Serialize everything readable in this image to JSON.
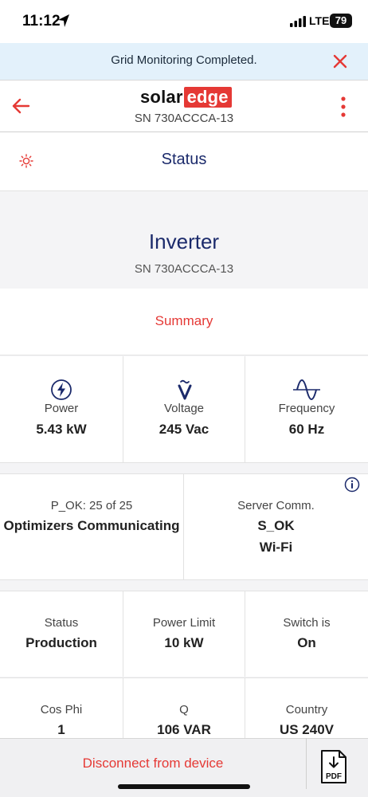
{
  "status_bar": {
    "time": "11:12",
    "network": "LTE",
    "battery": "79"
  },
  "banner": {
    "message": "Grid Monitoring Completed."
  },
  "app_bar": {
    "logo_solar": "solar",
    "logo_edge": "edge",
    "serial": "SN 730ACCCA-13"
  },
  "section": {
    "title": "Status"
  },
  "device": {
    "name": "Inverter",
    "serial": "SN 730ACCCA-13"
  },
  "summary": {
    "label": "Summary"
  },
  "metrics": [
    {
      "icon": "power-icon",
      "label": "Power",
      "value": "5.43 kW"
    },
    {
      "icon": "voltage-icon",
      "label": "Voltage",
      "value": "245 Vac"
    },
    {
      "icon": "frequency-icon",
      "label": "Frequency",
      "value": "60 Hz"
    }
  ],
  "communication": {
    "optimizers": {
      "label": "P_OK: 25 of 25",
      "value": "Optimizers Communicating"
    },
    "server": {
      "label": "Server Comm.",
      "status": "S_OK",
      "connection": "Wi-Fi"
    }
  },
  "status_grid": [
    {
      "label": "Status",
      "value": "Production"
    },
    {
      "label": "Power Limit",
      "value": "10 kW"
    },
    {
      "label": "Switch is",
      "value": "On"
    }
  ],
  "grid_row2": [
    {
      "label": "Cos Phi",
      "value": "1"
    },
    {
      "label": "Q",
      "value": "106 VAR"
    },
    {
      "label": "Country",
      "value": "US 240V"
    }
  ],
  "bottom": {
    "disconnect_label": "Disconnect from device",
    "pdf_label": "PDF"
  },
  "colors": {
    "accent_red": "#e53935",
    "navy": "#1b2a6b",
    "banner_bg": "#e3f1fb"
  }
}
